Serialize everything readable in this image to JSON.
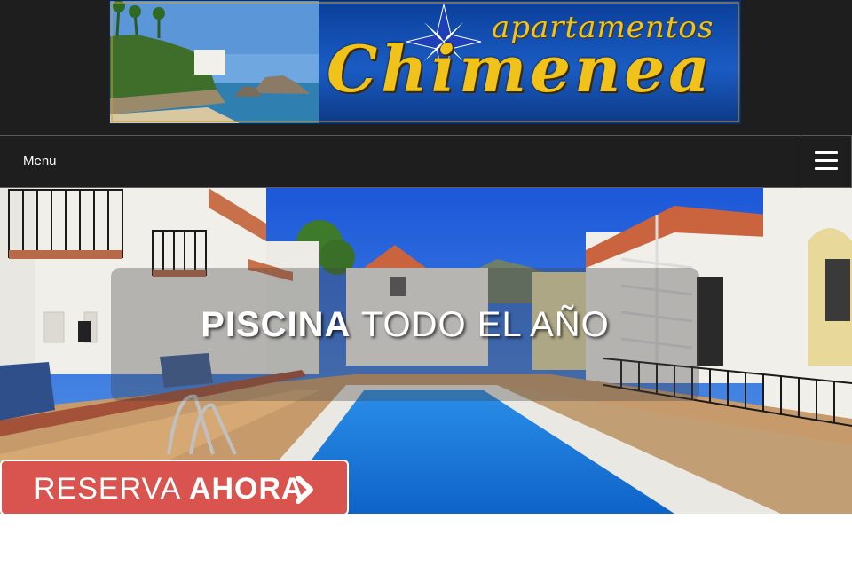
{
  "banner": {
    "brand_sub": "apartamentos",
    "brand_main": "Chimenea"
  },
  "nav": {
    "menu_label": "Menu",
    "toggle_icon": "hamburger-icon"
  },
  "hero": {
    "caption_bold": "PISCINA",
    "caption_light": " TODO EL AÑO"
  },
  "cta": {
    "light": "RESERVA ",
    "bold": "AHORA",
    "icon": "chevron-right-icon",
    "color": "#d9534f"
  },
  "colors": {
    "header_bg": "#1e1e1e",
    "brand_gold": "#f0c21a",
    "cta_red": "#d9534f"
  }
}
